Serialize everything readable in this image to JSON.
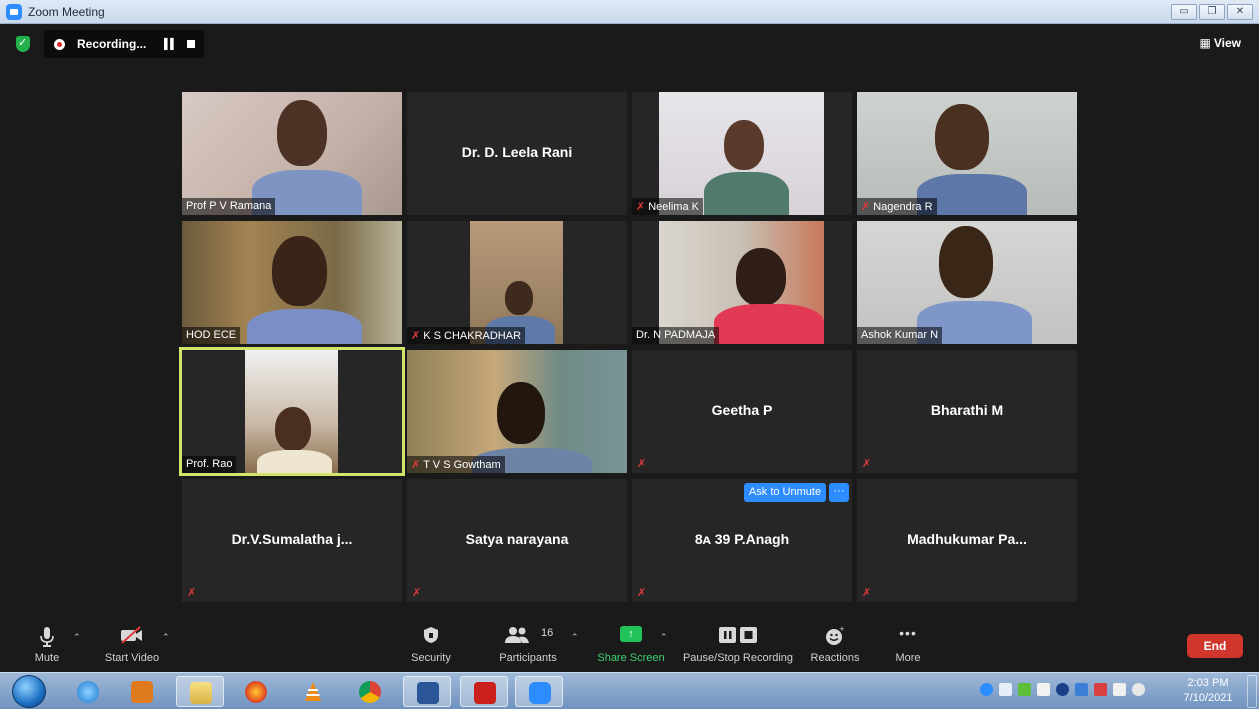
{
  "window": {
    "title": "Zoom Meeting"
  },
  "topbar": {
    "recording_text": "Recording...",
    "view_label": "View"
  },
  "tiles": [
    {
      "name": "Prof P V Ramana",
      "muted": false,
      "video": true
    },
    {
      "name": "Dr. D. Leela Rani",
      "muted": false,
      "video": false
    },
    {
      "name": "Neelima K",
      "muted": true,
      "video": true
    },
    {
      "name": "Nagendra R",
      "muted": true,
      "video": true
    },
    {
      "name": "HOD ECE",
      "muted": false,
      "video": true
    },
    {
      "name": "K S CHAKRADHAR",
      "muted": true,
      "video": true
    },
    {
      "name": "Dr. N PADMAJA",
      "muted": false,
      "video": true
    },
    {
      "name": "Ashok Kumar N",
      "muted": false,
      "video": true
    },
    {
      "name": "Prof. Rao",
      "muted": false,
      "video": true
    },
    {
      "name": "T V S Gowtham",
      "muted": true,
      "video": true
    },
    {
      "name": "Geetha P",
      "muted": true,
      "video": false
    },
    {
      "name": "Bharathi M",
      "muted": true,
      "video": false
    },
    {
      "name": "Dr.V.Sumalatha  j...",
      "muted": true,
      "video": false
    },
    {
      "name": "Satya narayana",
      "muted": true,
      "video": false
    },
    {
      "name": "8ᴀ 39 P.Anagh",
      "muted": true,
      "video": false
    },
    {
      "name": "Madhukumar  Pa...",
      "muted": true,
      "video": false
    }
  ],
  "hover": {
    "ask_unmute": "Ask to Unmute",
    "more": "···"
  },
  "toolbar": {
    "mute": "Mute",
    "start_video": "Start Video",
    "security": "Security",
    "participants": "Participants",
    "participants_count": "16",
    "share_screen": "Share Screen",
    "pause_stop": "Pause/Stop Recording",
    "reactions": "Reactions",
    "more": "More",
    "end": "End"
  },
  "taskbar": {
    "time": "2:03 PM",
    "date": "7/10/2021"
  },
  "colors": {
    "accent": "#2d8cff",
    "end": "#d0362c",
    "share": "#22c25a",
    "mute": "#e0393b",
    "active_speaker": "#d3e46a"
  }
}
